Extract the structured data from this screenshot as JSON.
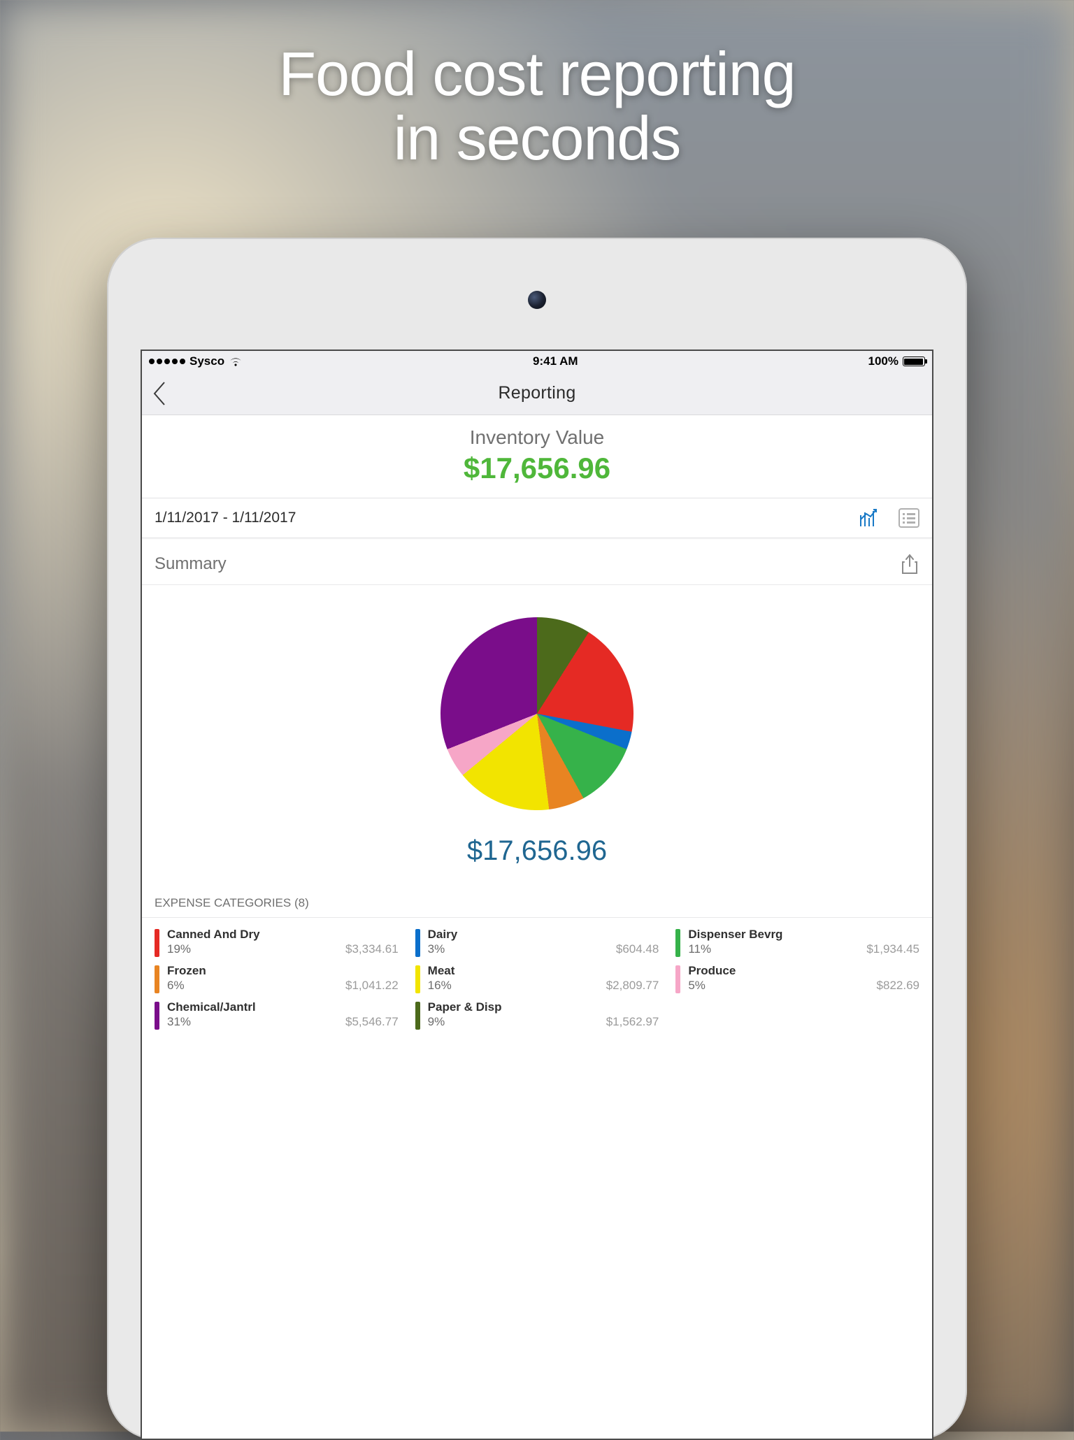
{
  "promo": {
    "line1": "Food cost reporting",
    "line2": "in seconds"
  },
  "statusbar": {
    "carrier": "Sysco",
    "time": "9:41 AM",
    "battery_pct": "100%"
  },
  "nav": {
    "title": "Reporting"
  },
  "inventory": {
    "label": "Inventory Value",
    "amount": "$17,656.96"
  },
  "daterow": {
    "range": "1/11/2017 - 1/11/2017"
  },
  "summary": {
    "label": "Summary"
  },
  "pie_total": "$17,656.96",
  "expense_header": "EXPENSE CATEGORIES (8)",
  "categories": [
    {
      "name": "Canned And Dry",
      "pct": "19%",
      "amount": "$3,334.61",
      "color": "#e52a24"
    },
    {
      "name": "Dairy",
      "pct": "3%",
      "amount": "$604.48",
      "color": "#0b6fcb"
    },
    {
      "name": "Dispenser Bevrg",
      "pct": "11%",
      "amount": "$1,934.45",
      "color": "#36b24a"
    },
    {
      "name": "Frozen",
      "pct": "6%",
      "amount": "$1,041.22",
      "color": "#e88422"
    },
    {
      "name": "Meat",
      "pct": "16%",
      "amount": "$2,809.77",
      "color": "#f2e400"
    },
    {
      "name": "Produce",
      "pct": "5%",
      "amount": "$822.69",
      "color": "#f6a6c7"
    },
    {
      "name": "Chemical/Jantrl",
      "pct": "31%",
      "amount": "$5,546.77",
      "color": "#7a0d8a"
    },
    {
      "name": "Paper & Disp",
      "pct": "9%",
      "amount": "$1,562.97",
      "color": "#4c6a1b"
    }
  ],
  "chart_data": {
    "type": "pie",
    "title": "Expense Categories",
    "series": [
      {
        "name": "Canned And Dry",
        "value": 19,
        "amount": 3334.61,
        "color": "#e52a24"
      },
      {
        "name": "Dairy",
        "value": 3,
        "amount": 604.48,
        "color": "#0b6fcb"
      },
      {
        "name": "Dispenser Bevrg",
        "value": 11,
        "amount": 1934.45,
        "color": "#36b24a"
      },
      {
        "name": "Frozen",
        "value": 6,
        "amount": 1041.22,
        "color": "#e88422"
      },
      {
        "name": "Meat",
        "value": 16,
        "amount": 2809.77,
        "color": "#f2e400"
      },
      {
        "name": "Produce",
        "value": 5,
        "amount": 822.69,
        "color": "#f6a6c7"
      },
      {
        "name": "Chemical/Jantrl",
        "value": 31,
        "amount": 5546.77,
        "color": "#7a0d8a"
      },
      {
        "name": "Paper & Disp",
        "value": 9,
        "amount": 1562.97,
        "color": "#4c6a1b"
      }
    ],
    "total": 17656.96
  }
}
